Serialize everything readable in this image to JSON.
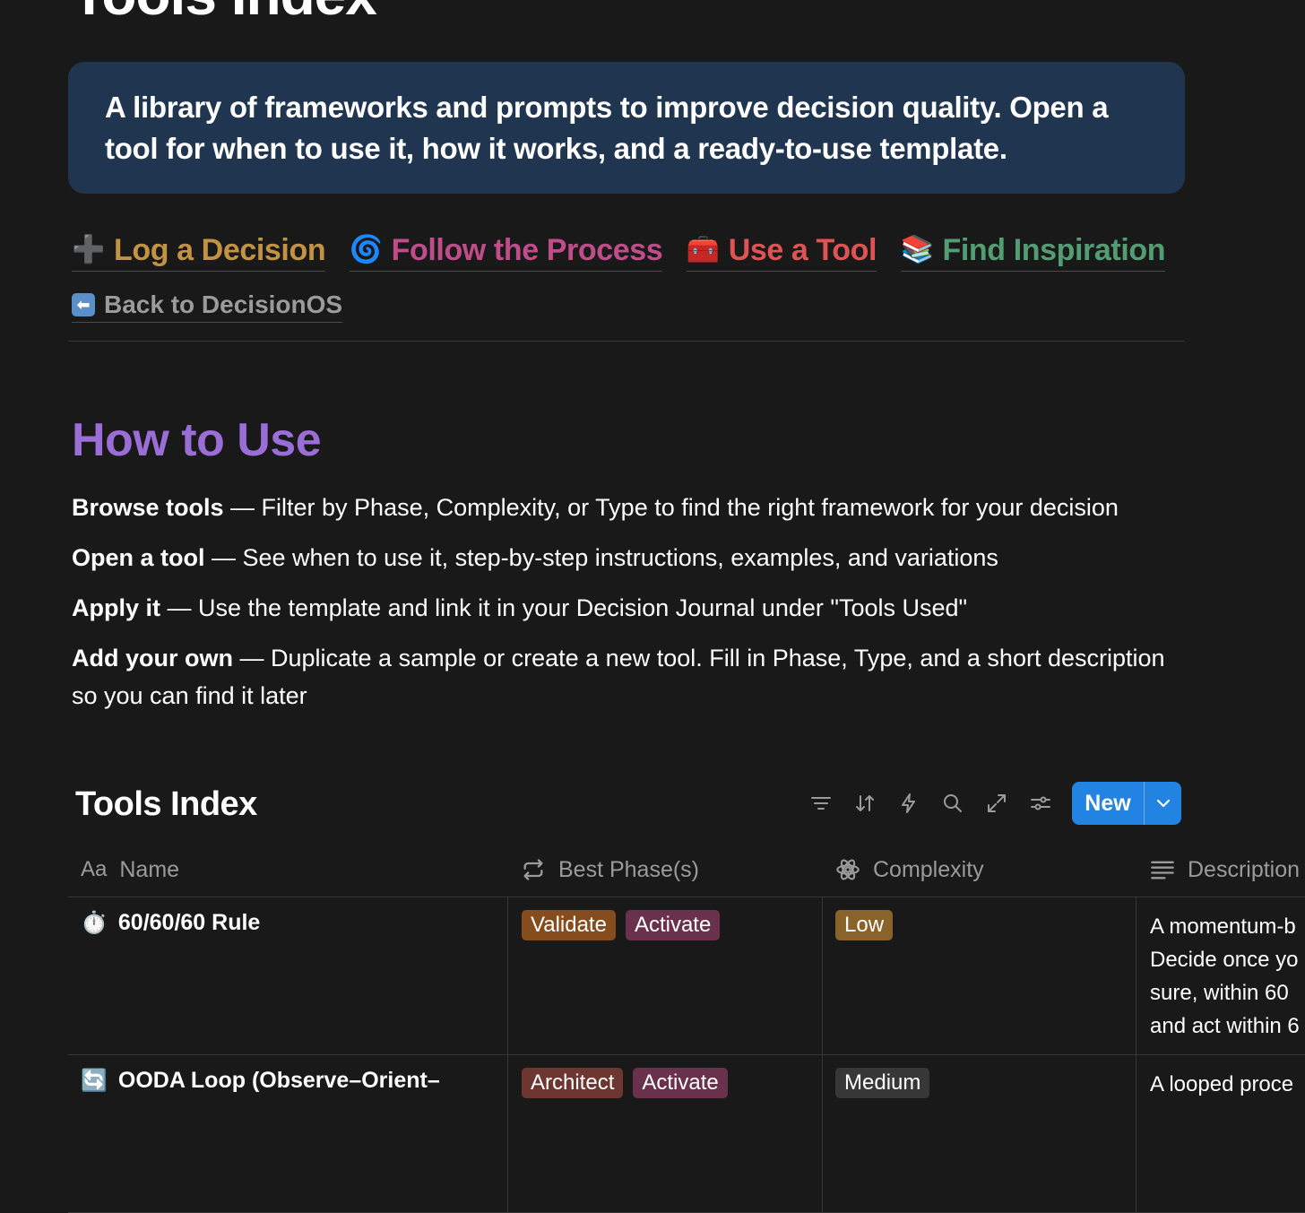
{
  "page": {
    "title": "Tools Index"
  },
  "callout": {
    "text": "A library of frameworks and prompts to improve decision quality. Open a tool for when to use it, how it works, and a ready-to-use template."
  },
  "nav": {
    "links": [
      {
        "emoji": "➕",
        "label": "Log a Decision",
        "color": "#c29343"
      },
      {
        "emoji": "🌀",
        "label": "Follow the Process",
        "color": "#c14c8a"
      },
      {
        "emoji": "🧰",
        "label": "Use a Tool",
        "color": "#df5452"
      },
      {
        "emoji": "📚",
        "label": "Find Inspiration",
        "color": "#529e72"
      }
    ],
    "back": {
      "emoji": "⬅",
      "label": "Back to DecisionOS"
    }
  },
  "how_to": {
    "heading": "How to Use",
    "items": [
      {
        "bold": "Browse tools",
        "text": " — Filter by Phase, Complexity, or Type to find the right framework for your decision"
      },
      {
        "bold": "Open a tool",
        "text": " — See when to use it, step-by-step instructions, examples, and variations"
      },
      {
        "bold": "Apply it",
        "text": " — Use the template and link it in your Decision Journal under \"Tools Used\""
      },
      {
        "bold": "Add your own",
        "text": " — Duplicate a sample or create a new tool. Fill in Phase, Type, and a short description so you can find it later"
      }
    ]
  },
  "database": {
    "title": "Tools Index",
    "toolbar": {
      "icons": [
        "filter-icon",
        "sort-icon",
        "automation-icon",
        "search-icon",
        "expand-icon",
        "settings-icon"
      ],
      "new_label": "New"
    },
    "columns": [
      {
        "icon": "Aa",
        "label": "Name"
      },
      {
        "icon": "relation-icon",
        "label": "Best Phase(s)"
      },
      {
        "icon": "select-icon",
        "label": "Complexity"
      },
      {
        "icon": "text-icon",
        "label": "Description"
      }
    ],
    "rows": [
      {
        "emoji": "⏱️",
        "name": "60/60/60 Rule",
        "phases": [
          {
            "label": "Validate",
            "color": "#854c1d"
          },
          {
            "label": "Activate",
            "color": "#69314c"
          }
        ],
        "complexity": {
          "label": "Low",
          "color": "#89632a"
        },
        "description_lines": [
          "A momentum-b",
          "Decide once yo",
          "sure, within 60",
          "and act within 6"
        ]
      },
      {
        "emoji": "🔄",
        "name": "OODA Loop (Observe–Orient–",
        "phases": [
          {
            "label": "Architect",
            "color": "#6e3630"
          },
          {
            "label": "Activate",
            "color": "#69314c"
          }
        ],
        "complexity": {
          "label": "Medium",
          "color": "#373737"
        },
        "description_lines": [
          "A looped proce"
        ]
      }
    ]
  }
}
